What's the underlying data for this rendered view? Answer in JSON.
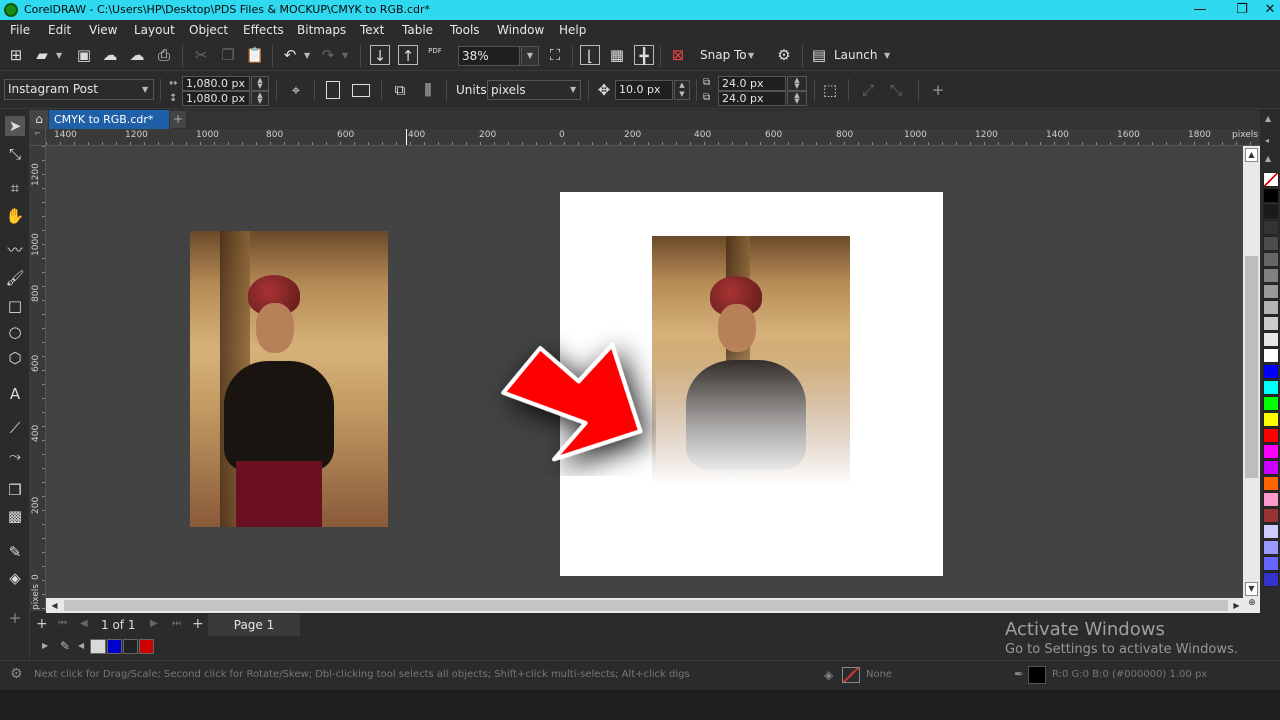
{
  "app": {
    "title": "CorelDRAW - C:\\Users\\HP\\Desktop\\PDS Files & MOCKUP\\CMYK to RGB.cdr*"
  },
  "menu": [
    "File",
    "Edit",
    "View",
    "Layout",
    "Object",
    "Effects",
    "Bitmaps",
    "Text",
    "Table",
    "Tools",
    "Window",
    "Help"
  ],
  "toolbar": {
    "zoom": "38%",
    "snap_to": "Snap To",
    "launch": "Launch",
    "pdf": "PDF"
  },
  "propbar": {
    "page_preset": "Instagram Post",
    "width": "1,080.0 px",
    "height": "1,080.0 px",
    "units_label": "Units:",
    "units_value": "pixels",
    "nudge": "10.0 px",
    "dup_x": "24.0 px",
    "dup_y": "24.0 px"
  },
  "doc_tab": "CMYK to RGB.cdr*",
  "hruler": {
    "labels": [
      "1400",
      "1200",
      "1000",
      "800",
      "600",
      "400",
      "200",
      "0",
      "200",
      "400",
      "600",
      "800",
      "1000",
      "1200",
      "1400",
      "1600",
      "1800",
      "pixels"
    ]
  },
  "vruler": {
    "labels": [
      "1200",
      "1000",
      "800",
      "600",
      "400",
      "200",
      "0",
      "pixels"
    ]
  },
  "pages": {
    "counter": "1 of 1",
    "tab": "Page 1"
  },
  "activation": {
    "line1": "Activate Windows",
    "line2": "Go to Settings to activate Windows."
  },
  "status": {
    "hint": "Next click for Drag/Scale; Second click for Rotate/Skew; Dbl-clicking tool selects all objects; Shift+click multi-selects; Alt+click digs",
    "fill": "None",
    "outline": "R:0 G:0 B:0 (#000000)  1.00 px"
  },
  "palette_colors": [
    "#ffffff",
    "#000000",
    "#1a1a1a",
    "#333333",
    "#4d4d4d",
    "#666666",
    "#808080",
    "#999999",
    "#b3b3b3",
    "#cccccc",
    "#e6e6e6",
    "#ffffff",
    "#0000ff",
    "#00ffff",
    "#00ff00",
    "#ffff00",
    "#ff0000",
    "#ff00ff",
    "#cc00ff",
    "#ff6600",
    "#ff99cc",
    "#993333",
    "#ccccff",
    "#9999ff",
    "#6666ff",
    "#3333cc"
  ],
  "doc_palette": [
    "#d9d9d9",
    "#0000cc",
    "#222222",
    "#cc0000"
  ],
  "colors": {
    "accent": "#2fd9f0",
    "arrow": "#ff0000",
    "tab_active": "#1e5fa8"
  }
}
